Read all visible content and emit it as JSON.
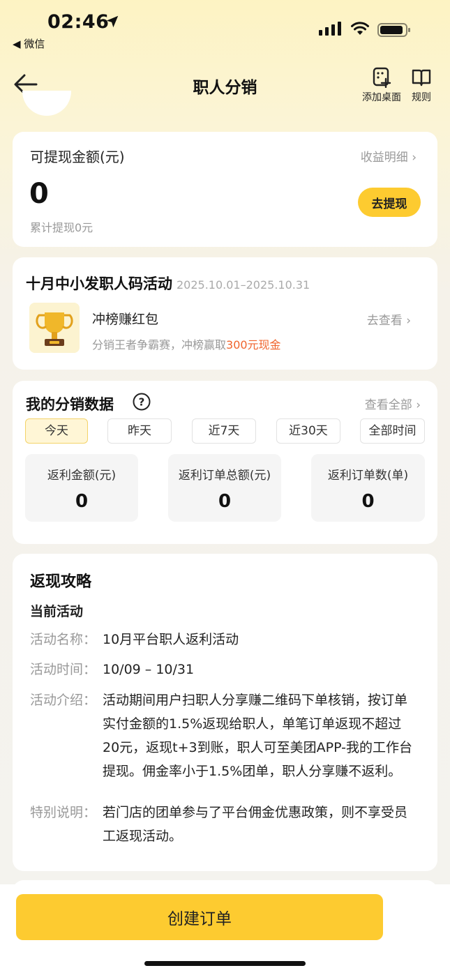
{
  "status_bar": {
    "time": "02:46",
    "back_app": "◀ 微信"
  },
  "nav": {
    "title": "职人分销",
    "add_desktop": "添加桌面",
    "rules": "规则"
  },
  "balance": {
    "label": "可提现金额(元)",
    "detail_link": "收益明细 ›",
    "value": "0",
    "total_withdrawn": "累计提现0元",
    "withdraw_button": "去提现"
  },
  "activity": {
    "title": "十月中小发职人码活动",
    "date_range": "2025.10.01–2025.10.31",
    "subtitle": "冲榜赚红包",
    "desc_prefix": "分销王者争霸赛，冲榜赢取",
    "desc_highlight": "300元现金",
    "link": "去查看 ›"
  },
  "data_section": {
    "title": "我的分销数据",
    "view_all": "查看全部 ›",
    "tabs": [
      "今天",
      "昨天",
      "近7天",
      "近30天",
      "全部时间"
    ],
    "active_tab": "今天",
    "stats": [
      {
        "label": "返利金额(元)",
        "value": "0"
      },
      {
        "label": "返利订单总额(元)",
        "value": "0"
      },
      {
        "label": "返利订单数(单)",
        "value": "0"
      }
    ]
  },
  "guide": {
    "title": "返现攻略",
    "subtitle": "当前活动",
    "rows": [
      {
        "key": "活动名称：",
        "value": "10月平台职人返利活动"
      },
      {
        "key": "活动时间：",
        "value": "10/09 – 10/31"
      },
      {
        "key": "活动介绍：",
        "value": "活动期间用户扫职人分享赚二维码下单核销，按订单实付金额的1.5%返现给职人，单笔订单返现不超过20元，返现t+3到账，职人可至美团APP-我的工作台提现。佣金率小于1.5%团单，职人分享赚不返利。"
      },
      {
        "key": "特别说明：",
        "value": "若门店的团单参与了平台佣金优惠政策，则不享受员工返现活动。"
      }
    ]
  },
  "bottom": {
    "create_button": "创建订单"
  },
  "colors": {
    "accent": "#fdcb30",
    "highlight": "#f0642d",
    "header_bg": "#fdf3c3"
  }
}
